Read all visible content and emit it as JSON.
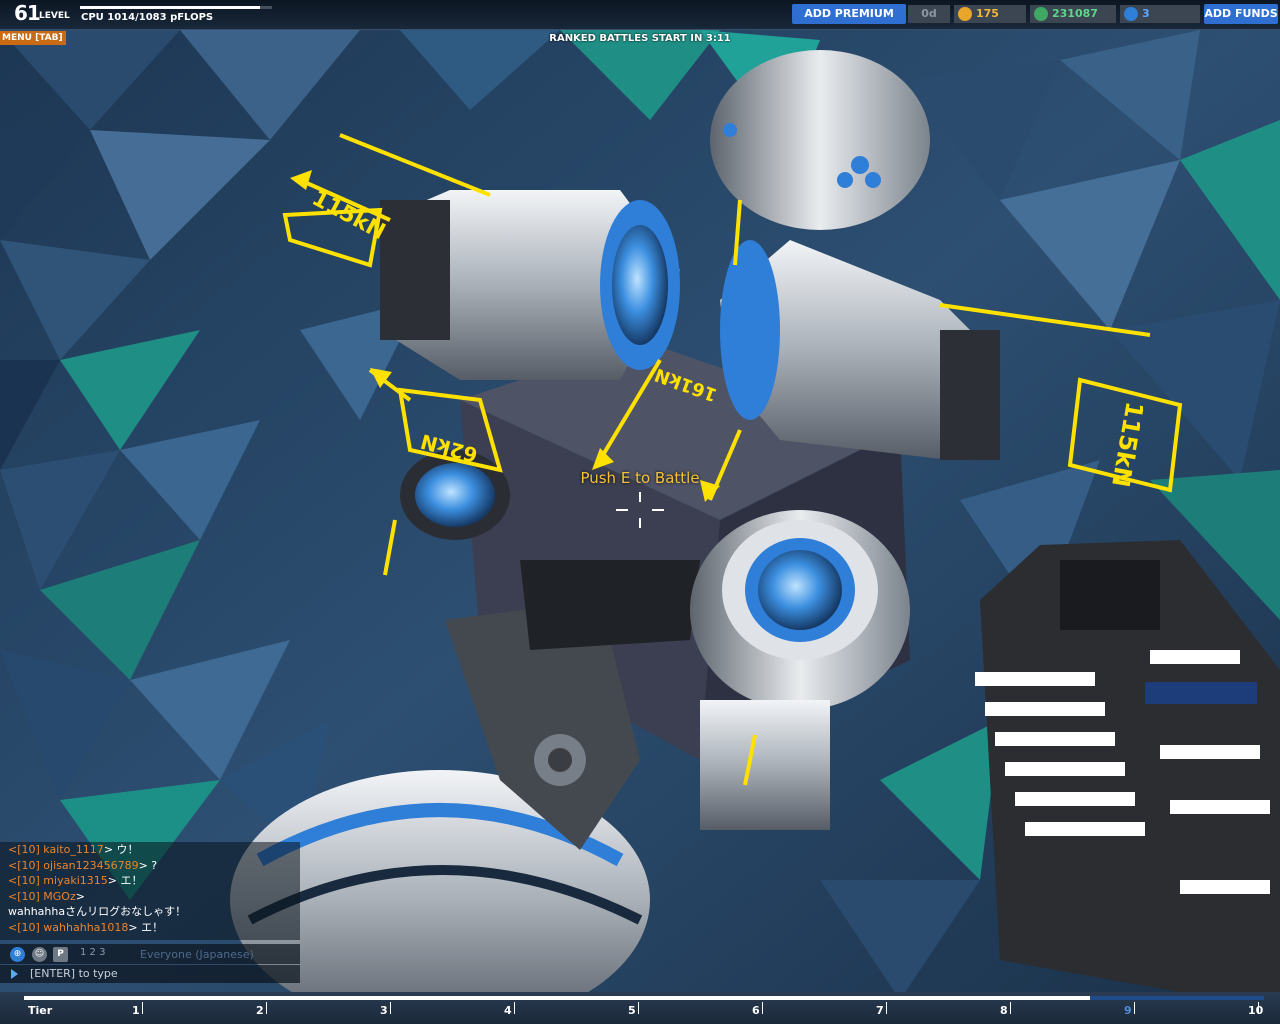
{
  "hud": {
    "level_number": "61",
    "level_word": "LEVEL",
    "cpu_text": "CPU 1014/1083 pFLOPS",
    "cpu_fraction": 0.936,
    "add_premium": "ADD PREMIUM",
    "premium_days": "0d",
    "tech_points": "175",
    "robits": "231087",
    "galaxy_coins": "3",
    "add_funds": "ADD FUNDS",
    "menu_tab": "MENU [TAB]",
    "ranked_banner": "RANKED BATTLES START IN 3:11",
    "prompt": "Push E to Battle"
  },
  "thrust_labels": [
    "115kN",
    "115kN",
    "161kN",
    "62kN"
  ],
  "chat": {
    "lines": [
      {
        "prefix": "<[10] ",
        "user": "kaito_1117",
        "msg": "> ウ！"
      },
      {
        "prefix": "<[10] ",
        "user": "ojisan123456789",
        "msg": "> ?"
      },
      {
        "prefix": "<[10] ",
        "user": "miyaki1315",
        "msg": "> エ！"
      },
      {
        "prefix": "<[10] ",
        "user": "MGOz",
        "msg": ">"
      },
      {
        "prefix": "",
        "user": "",
        "msg": "wahhahhaさんリログおなしゃす！"
      },
      {
        "prefix": "<[10] ",
        "user": "wahhahha1018",
        "msg": "> エ！"
      }
    ],
    "channel_nums": "1  2  3",
    "channel_label": "Everyone (Japanese)",
    "input_placeholder": "[ENTER] to type"
  },
  "tier": {
    "label": "Tier",
    "ticks": [
      "1",
      "2",
      "3",
      "4",
      "5",
      "6",
      "7",
      "8",
      "9",
      "10"
    ],
    "progress_fraction": 0.86,
    "current_tier": "9"
  },
  "colors": {
    "accent_blue": "#2f6fd1",
    "hud_yellow": "#f5c13a",
    "chat_orange": "#e9842c",
    "menu_orange": "#c96a14"
  }
}
